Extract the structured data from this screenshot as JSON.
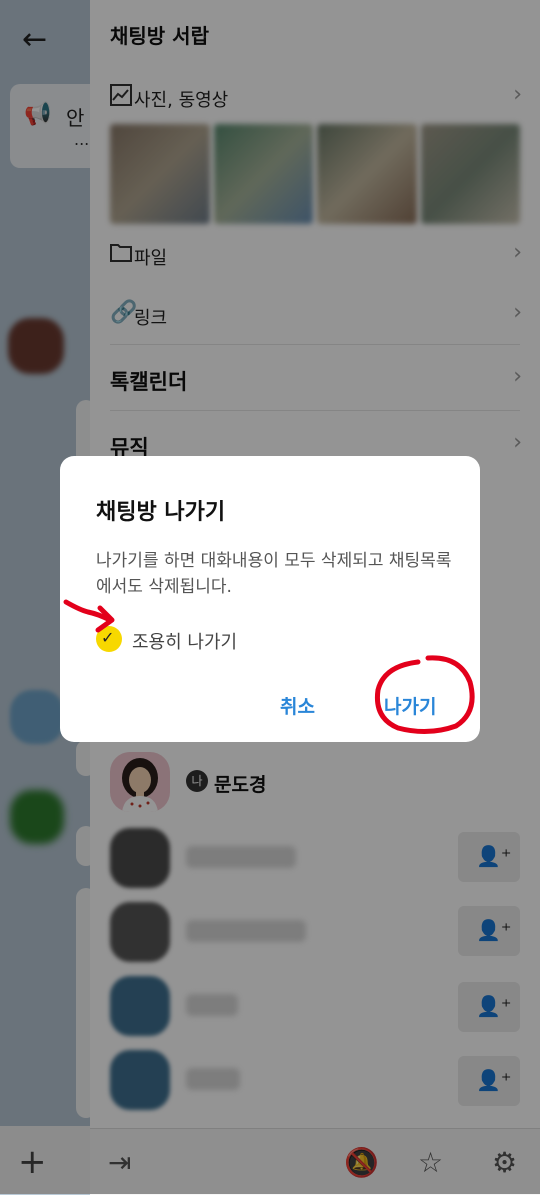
{
  "chat": {
    "notice_title": "안",
    "notice_dots": "..."
  },
  "drawer": {
    "title": "채팅방 서랍",
    "items": {
      "media": "사진, 동영상",
      "files": "파일",
      "links": "링크",
      "calendar": "톡캘린더",
      "music": "뮤직"
    },
    "featured_member": {
      "badge": "나",
      "name": "문도경"
    }
  },
  "dialog": {
    "title": "채팅방 나가기",
    "message": "나가기를 하면 대화내용이 모두 삭제되고 채팅목록에서도 삭제됩니다.",
    "checkbox_label": "조용히 나가기",
    "cancel": "취소",
    "leave": "나가기"
  },
  "colors": {
    "accent_blue": "#2a86d8",
    "check_yellow": "#f7d800",
    "annotation_red": "#e3001b"
  }
}
